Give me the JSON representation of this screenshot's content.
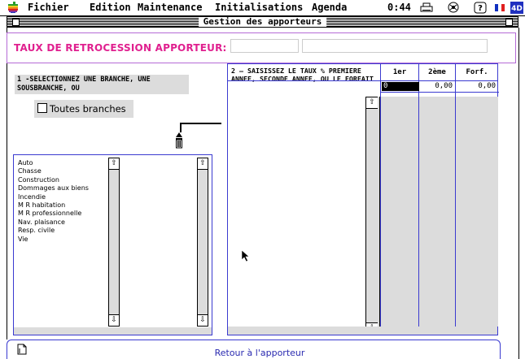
{
  "menubar": {
    "items": [
      "Fichier",
      "Edition",
      "Maintenance",
      "Initialisations",
      "Agenda"
    ],
    "clock": "0:44",
    "icons": [
      "printer-icon",
      "network-icon",
      "help-icon",
      "flag-fr-icon",
      "4d-app-icon"
    ]
  },
  "window": {
    "title": "Gestion des apporteurs"
  },
  "header": {
    "label": "TAUX DE RETROCESSION APPORTEUR:"
  },
  "branches": {
    "instruction": "1 -SELECTIONNEZ UNE BRANCHE, UNE SOUSBRANCHE, OU",
    "all_label": "Toutes branches",
    "items": [
      "Auto",
      "Chasse",
      "Construction",
      "Dommages aux biens",
      "Incendie",
      "M R habitation",
      "M R professionnelle",
      "Nav. plaisance",
      "Resp. civile",
      "Vie"
    ]
  },
  "rates": {
    "instruction": "2 – SAISISSEZ LE TAUX % PREMIERE  ANNEE, SECONDE ANNEE, OU LE FORFAIT",
    "col_1er": "1er",
    "col_2eme": "2ème",
    "col_forf": "Forf.",
    "val_1er": "0",
    "val_2eme": "0,00",
    "val_forf": "0,00"
  },
  "footer": {
    "return_label": "Retour à l'apporteur"
  },
  "colors": {
    "accent_pink": "#e0208f",
    "panel_border": "#3a3ad0",
    "gray": "#dcdcdc"
  }
}
